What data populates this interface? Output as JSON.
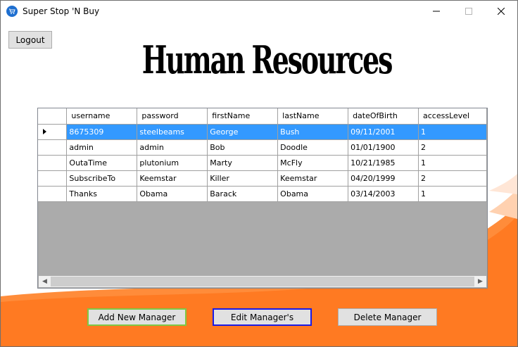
{
  "window": {
    "title": "Super Stop 'N Buy",
    "controls": [
      "minimize",
      "maximize",
      "close"
    ]
  },
  "toolbar": {
    "logout_label": "Logout"
  },
  "page": {
    "heading": "Human Resources"
  },
  "grid": {
    "columns": [
      "username",
      "password",
      "firstName",
      "lastName",
      "dateOfBirth",
      "accessLevel"
    ],
    "rows": [
      [
        "8675309",
        "steelbeams",
        "George",
        "Bush",
        "09/11/2001",
        "1"
      ],
      [
        "admin",
        "admin",
        "Bob",
        "Doodle",
        "01/01/1900",
        "2"
      ],
      [
        "OutaTime",
        "plutonium",
        "Marty",
        "McFly",
        "10/21/1985",
        "1"
      ],
      [
        "SubscribeTo",
        "Keemstar",
        "Killer",
        "Keemstar",
        "04/20/1999",
        "2"
      ],
      [
        "Thanks",
        "Obama",
        "Barack",
        "Obama",
        "03/14/2003",
        "1"
      ]
    ],
    "selected_row": 0
  },
  "actions": {
    "add_label": "Add New Manager",
    "edit_label": "Edit Manager's",
    "delete_label": "Delete Manager"
  },
  "colors": {
    "selection": "#3399ff",
    "accent_orange": "#ff7f27",
    "grid_empty": "#ababab"
  }
}
